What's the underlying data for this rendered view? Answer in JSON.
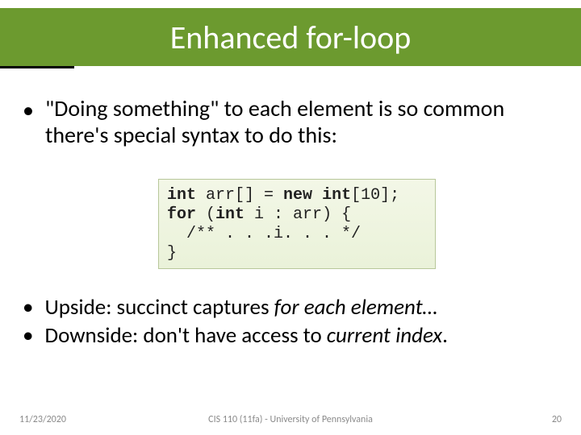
{
  "title": "Enhanced for-loop",
  "bullets_top": [
    "\"Doing something\" to each element is so common there's special syntax to do this:"
  ],
  "code": {
    "l1a": "int",
    "l1b": " arr[] = ",
    "l1c": "new",
    "l1d": " ",
    "l1e": "int",
    "l1f": "[10];",
    "l2a": "for",
    "l2b": " (",
    "l2c": "int",
    "l2d": " i : arr) {",
    "l3": "  /** . . .i. . . */",
    "l4": "}"
  },
  "bullets_bottom": [
    {
      "pre": "Upside: succinct captures ",
      "it": "for each element…"
    },
    {
      "pre": "Downside: don't have access to ",
      "it": "current index",
      "post": "."
    }
  ],
  "footer": {
    "date": "11/23/2020",
    "course": "CIS 110 (11fa) - University of Pennsylvania",
    "page": "20"
  }
}
